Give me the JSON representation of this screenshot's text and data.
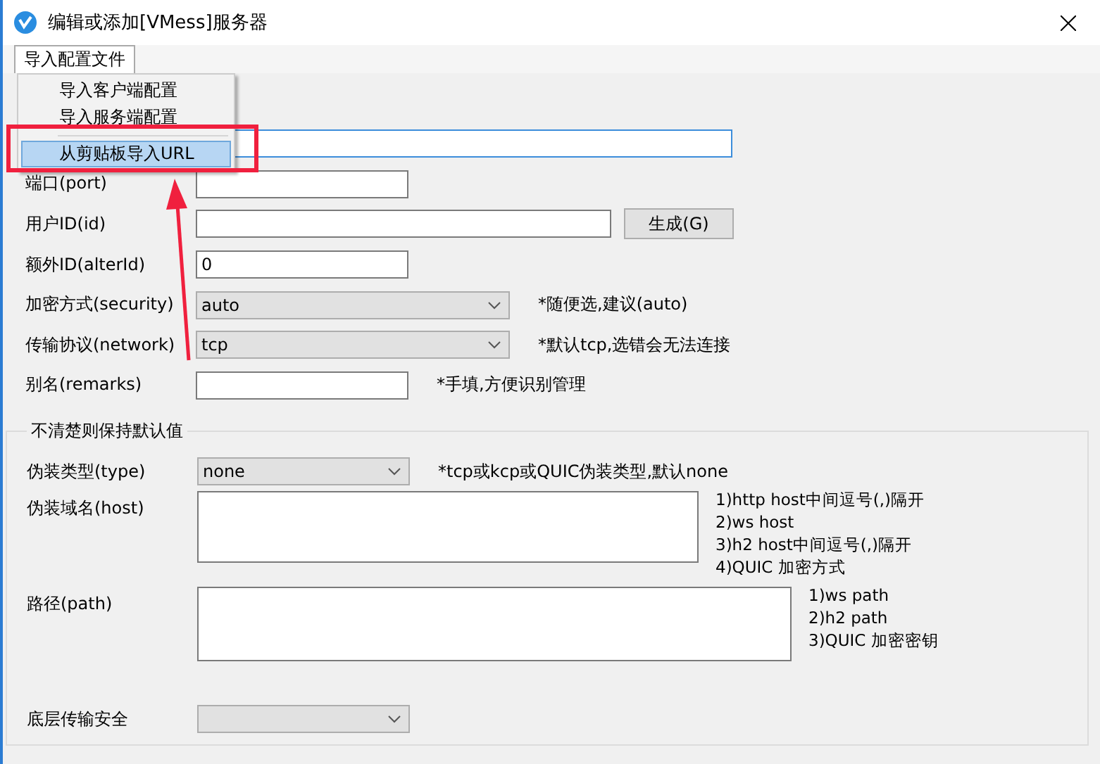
{
  "window": {
    "title": "编辑或添加[VMess]服务器"
  },
  "menu_bar": [
    {
      "label": "导入配置文件",
      "selected": true
    }
  ],
  "dropdown_menu": {
    "items": [
      {
        "label": "导入客户端配置",
        "selected": false
      },
      {
        "label": "导入服务端配置",
        "selected": false
      },
      {
        "kind": "separator"
      },
      {
        "label": "从剪贴板导入URL",
        "selected": true
      }
    ]
  },
  "fields": [
    {
      "kind": "text",
      "focused": true
    },
    {
      "kind": "text",
      "label": "端口(port)",
      "focused": false
    },
    {
      "kind": "text",
      "label": "用户ID(id)",
      "focused": false,
      "button": "生成(G)"
    },
    {
      "kind": "text",
      "label": "额外ID(alterId)",
      "value": "0",
      "focused": false
    },
    {
      "kind": "select",
      "label": "加密方式(security)",
      "value": "auto",
      "note": "*随便选,建议(auto)"
    },
    {
      "kind": "select",
      "label": "传输协议(network)",
      "value": "tcp",
      "note": "*默认tcp,选错会无法连接"
    },
    {
      "kind": "text",
      "label": "别名(remarks)",
      "focused": false,
      "note": "*手填,方便识别管理"
    }
  ],
  "group": {
    "title": "不清楚则保持默认值",
    "fields": [
      {
        "kind": "select",
        "label": "伪装类型(type)",
        "value": "none",
        "note": "*tcp或kcp或QUIC伪装类型,默认none"
      },
      {
        "kind": "textarea",
        "label": "伪装域名(host)",
        "notes": [
          "1)http host中间逗号(,)隔开",
          "2)ws host",
          "3)h2 host中间逗号(,)隔开",
          "4)QUIC 加密方式"
        ]
      },
      {
        "kind": "textarea",
        "label": "路径(path)",
        "notes": [
          "1)ws path",
          "2)h2 path",
          "3)QUIC 加密密钥"
        ]
      },
      {
        "kind": "select",
        "label": "底层传输安全"
      }
    ]
  }
}
